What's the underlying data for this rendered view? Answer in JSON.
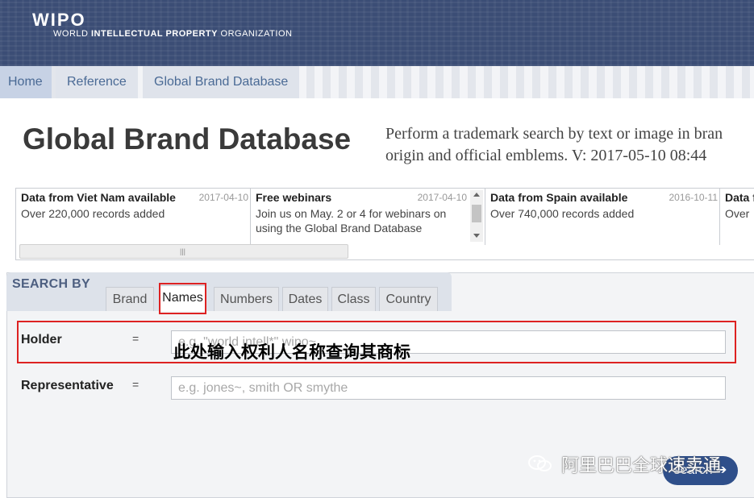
{
  "header": {
    "logo_wipo": "WIPO",
    "logo_org_1": "WORLD ",
    "logo_org_bold": "INTELLECTUAL PROPERTY",
    "logo_org_2": " ORGANIZATION"
  },
  "nav": {
    "items": [
      {
        "label": "Home"
      },
      {
        "label": "Reference"
      },
      {
        "label": "Global Brand Database"
      }
    ]
  },
  "page": {
    "title": "Global Brand Database",
    "description_line1": "Perform a trademark search by text or image in bran",
    "description_line2": "origin and official emblems. V: 2017-05-10 08:44"
  },
  "news": [
    {
      "title": "Data from Viet Nam available",
      "date": "2017-04-10",
      "text": "Over 220,000 records added"
    },
    {
      "title": "Free webinars",
      "date": "2017-04-10",
      "text": "Join us on May. 2 or 4 for webinars on using the Global Brand Database"
    },
    {
      "title": "Data from Spain available",
      "date": "2016-10-11",
      "text": "Over 740,000 records added"
    },
    {
      "title": "Data f",
      "date": "",
      "text": "Over"
    }
  ],
  "search": {
    "heading": "SEARCH BY",
    "tabs": [
      {
        "label": "Brand"
      },
      {
        "label": "Names"
      },
      {
        "label": "Numbers"
      },
      {
        "label": "Dates"
      },
      {
        "label": "Class"
      },
      {
        "label": "Country"
      }
    ],
    "active_tab": "Names",
    "fields": [
      {
        "label": "Holder",
        "operator": "=",
        "value": "",
        "placeholder": "e.g. \"world intell*\" wipo~"
      },
      {
        "label": "Representative",
        "operator": "=",
        "value": "",
        "placeholder": "e.g. jones~, smith OR smythe"
      }
    ],
    "search_button": "search"
  },
  "annotation": {
    "note": "此处输入权利人名称查询其商标",
    "color": "#dd2222"
  },
  "watermark": {
    "text": "阿里巴巴全球速卖通"
  },
  "colors": {
    "header_bg": "#3b4d75",
    "nav_text": "#4a6a95",
    "search_heading": "#4d5f80",
    "button_bg": "#2f4f8a"
  }
}
